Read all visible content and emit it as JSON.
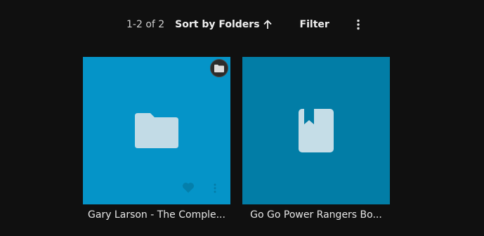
{
  "toolbar": {
    "count": "1-2 of 2",
    "sort_label": "Sort by Folders",
    "sort_icon": "arrow-up-icon",
    "filter_label": "Filter",
    "more_icon": "more-vertical-icon"
  },
  "items": [
    {
      "title": "Gary Larson - The Comple...",
      "icon": "folder-icon",
      "badge_icon": "folder-badge-icon",
      "tile_color": "#0594c8"
    },
    {
      "title": "Go Go Power Rangers Bo...",
      "icon": "book-icon",
      "tile_color": "#027da6"
    }
  ]
}
